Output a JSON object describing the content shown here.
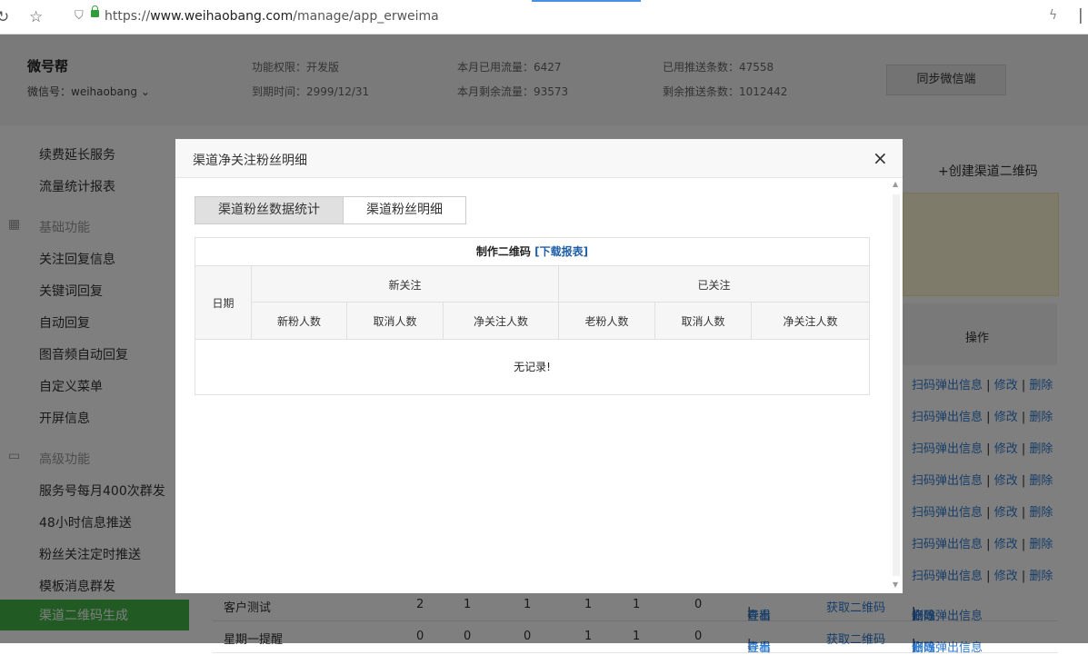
{
  "browser": {
    "url_prefix": "https://",
    "url_host": "www.weihaobang.com",
    "url_path": "/manage/app_erweima"
  },
  "header": {
    "brand": "微号帮",
    "wechat_id": "微信号：weihaobang",
    "permission": "功能权限：开发版",
    "expire": "到期时间：2999/12/31",
    "traffic_used": "本月已用流量：6427",
    "traffic_left": "本月剩余流量：93573",
    "push_used": "已用推送条数：47558",
    "push_left": "剩余推送条数：1012442",
    "sync_button": "同步微信端"
  },
  "sidebar": {
    "items_top": [
      "续费延长服务",
      "流量统计报表"
    ],
    "group_basic": "基础功能",
    "basic_items": [
      "关注回复信息",
      "关键词回复",
      "自动回复",
      "图音频自动回复",
      "自定义菜单",
      "开屏信息"
    ],
    "group_advanced": "高级功能",
    "advanced_items": [
      "服务号每月400次群发",
      "48小时信息推送",
      "粉丝关注定时推送",
      "模板消息群发"
    ],
    "active_item": "渠道二维码生成"
  },
  "main": {
    "create_link": "+创建渠道二维码",
    "op_header": "操作",
    "op_link_1": "扫码弹出信息",
    "op_link_2": "修改",
    "op_link_3": "删除",
    "op_sep": "|",
    "rows": [
      {
        "name": "客户测试",
        "v1": "2",
        "v2": "1",
        "v3": "1",
        "v4": "1",
        "v5": "1",
        "v6": "0",
        "view": "查看",
        "export": "导出",
        "get_qr": "获取二维码"
      },
      {
        "name": "星期一提醒",
        "v1": "0",
        "v2": "0",
        "v3": "0",
        "v4": "1",
        "v5": "1",
        "v6": "0",
        "view": "查看",
        "export": "导出",
        "get_qr": "获取二维码"
      }
    ]
  },
  "modal": {
    "title": "渠道净关注粉丝明细",
    "close": "×",
    "tab_active": "渠道粉丝数据统计",
    "tab_inactive": "渠道粉丝明细",
    "caption_prefix": "制作二维码 ",
    "caption_link": "[下载报表]",
    "col_date": "日期",
    "group_new": "新关注",
    "group_existing": "已关注",
    "sub_new": [
      "新粉人数",
      "取消人数",
      "净关注人数"
    ],
    "sub_existing": [
      "老粉人数",
      "取消人数",
      "净关注人数"
    ],
    "empty_text": "无记录!"
  }
}
